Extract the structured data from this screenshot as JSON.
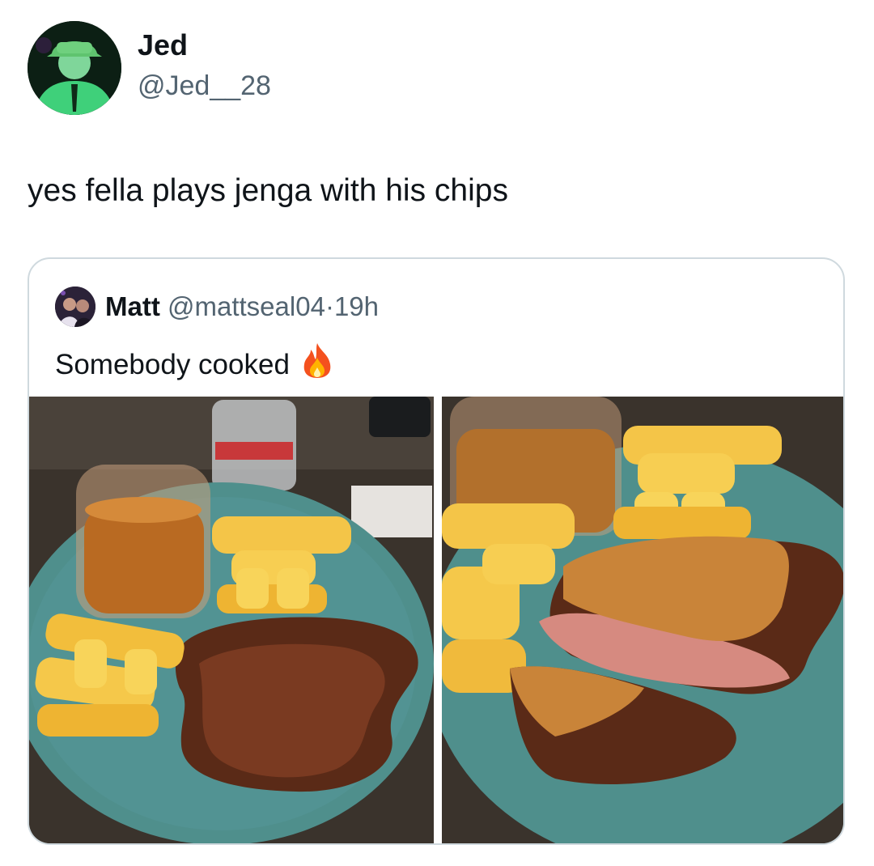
{
  "tweet": {
    "author_name": "Jed",
    "author_handle": "@Jed__28",
    "text": "yes fella plays jenga with his chips"
  },
  "quoted_tweet": {
    "author_name": "Matt",
    "author_handle": "@mattseal04",
    "separator": "·",
    "time": "19h",
    "text": "Somebody cooked",
    "emoji": "fire-icon"
  },
  "colors": {
    "handle_gray": "#536471",
    "border": "#cfd9de",
    "plate_teal": "#4f8f8c"
  }
}
